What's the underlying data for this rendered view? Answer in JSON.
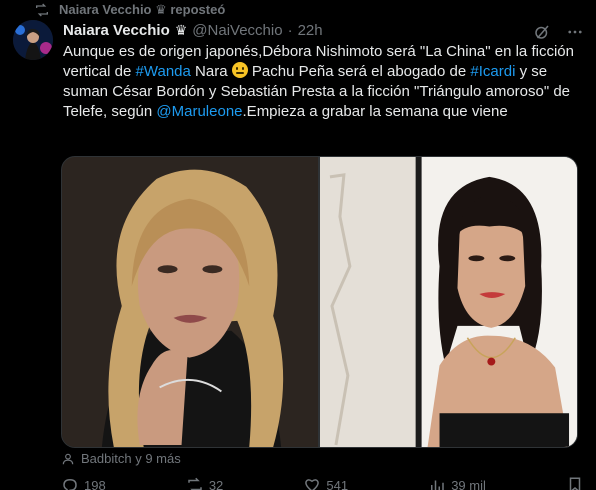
{
  "repost": {
    "label": "Naiara Vecchio ♛ reposteó",
    "icon": "repost-icon"
  },
  "author": {
    "display_name": "Naiara Vecchio",
    "badge": "♛",
    "handle": "@NaiVecchio",
    "separator": "·",
    "timestamp": "22h"
  },
  "tweet": {
    "t1": "Aunque es de origen japonés,Débora Nishimoto será \"La China\" en la ficción vertical de ",
    "hashtag_wanda": "#Wanda",
    "t2": " Nara ",
    "emoji": "grimacing-face-emoji",
    "t3": " Pachu Peña será el abogado de ",
    "hashtag_icardi": "#Icardi",
    "t4": " y se suman César Bordón y Sebastián Presta a la ficción \"Triángulo amoroso\" de Telefe, según ",
    "mention": "@Maruleone",
    "t5": ".Empieza a grabar la semana que viene"
  },
  "media": {
    "left_photo": "woman-with-blonde-wavy-hair-photo",
    "right_photo": "woman-with-dark-bangs-photo"
  },
  "tagged": {
    "label": "Badbitch y 9 más",
    "icon": "person-icon"
  },
  "actions": {
    "replies": "198",
    "reposts": "32",
    "likes": "541",
    "views": "39 mil"
  },
  "colors": {
    "accent": "#1d9bf0",
    "muted": "#71767b",
    "text": "#e7e9ea",
    "background": "#000000"
  }
}
